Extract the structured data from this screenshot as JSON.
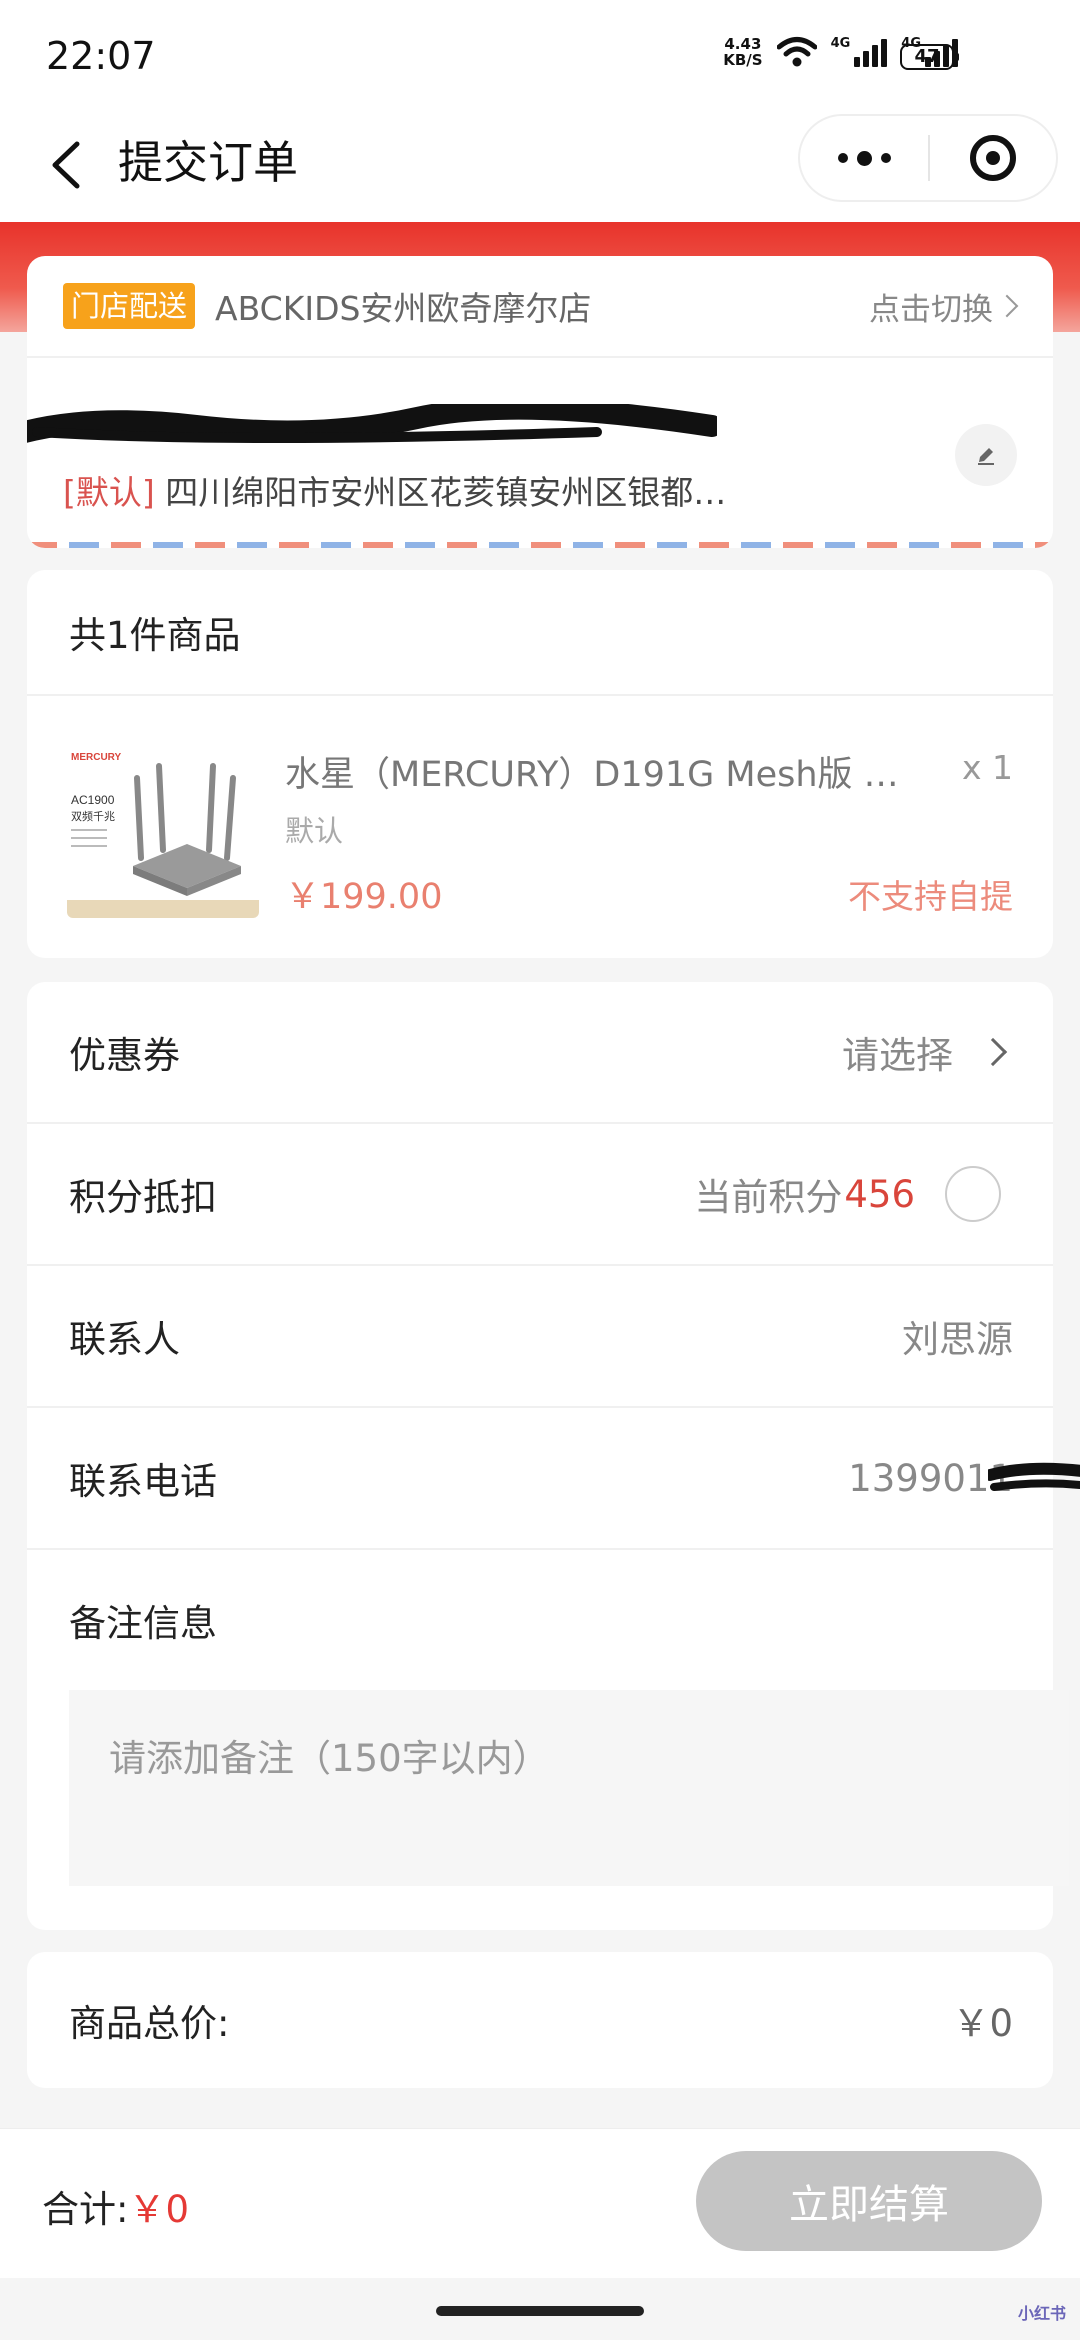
{
  "status_bar": {
    "time": "22:07",
    "net_speed_value": "4.43",
    "net_speed_unit": "KB/S",
    "signal_label_1": "4G",
    "signal_label_2": "4G",
    "battery": "47"
  },
  "nav": {
    "title": "提交订单"
  },
  "store": {
    "tag": "门店配送",
    "name": "ABCKIDS安州欧奇摩尔店",
    "switch_label": "点击切换"
  },
  "address": {
    "default_tag": "[默认]",
    "text": "四川绵阳市安州区花荄镇安州区银都…"
  },
  "goods": {
    "count_label": "共1件商品",
    "item": {
      "name": "水星（MERCURY）D191G Mesh版 …",
      "qty": "x 1",
      "spec": "默认",
      "price": "￥199.00",
      "pickup": "不支持自提",
      "image_brand": "MERCURY",
      "image_model": "AC1900",
      "image_desc": "双频千兆"
    }
  },
  "form": {
    "coupon": {
      "label": "优惠券",
      "value": "请选择"
    },
    "points": {
      "label": "积分抵扣",
      "prefix": "当前积分",
      "value": "456"
    },
    "contact": {
      "label": "联系人",
      "value": "刘思源"
    },
    "phone": {
      "label": "联系电话",
      "value": "1399011"
    },
    "remark": {
      "label": "备注信息",
      "placeholder": "请添加备注（150字以内）"
    }
  },
  "total": {
    "label": "商品总价:",
    "value": "￥0"
  },
  "bottom": {
    "sum_label": "合计:",
    "sum_value": "￥0",
    "submit_label": "立即结算"
  },
  "colors": {
    "primary_red": "#e8332b",
    "store_tag": "#f7a21b",
    "price": "#e9806f",
    "disabled_button": "#c4c4c4"
  },
  "watermark": "小红书"
}
